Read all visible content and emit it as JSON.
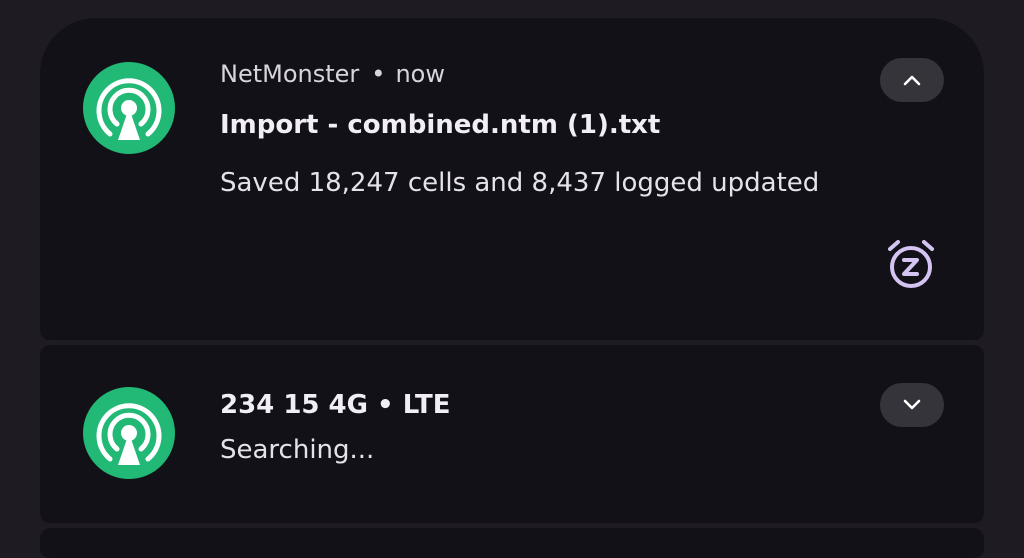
{
  "notifications": [
    {
      "app_name": "NetMonster",
      "separator": "•",
      "time": "now",
      "title": "Import - combined.ntm (1).txt",
      "body": "Saved 18,247 cells and 8,437 logged updated",
      "expand_state": "expanded",
      "icon": "netmonster-antenna-icon",
      "action_icon": "snooze-alarm-icon"
    },
    {
      "title": "234 15 4G • LTE",
      "body": "Searching...",
      "expand_state": "collapsed",
      "icon": "netmonster-antenna-icon"
    }
  ],
  "colors": {
    "background": "#1e1c22",
    "card": "#131118",
    "icon_green": "#22b875",
    "button_bg": "#36343b",
    "snooze_purple": "#d3c4f2"
  }
}
